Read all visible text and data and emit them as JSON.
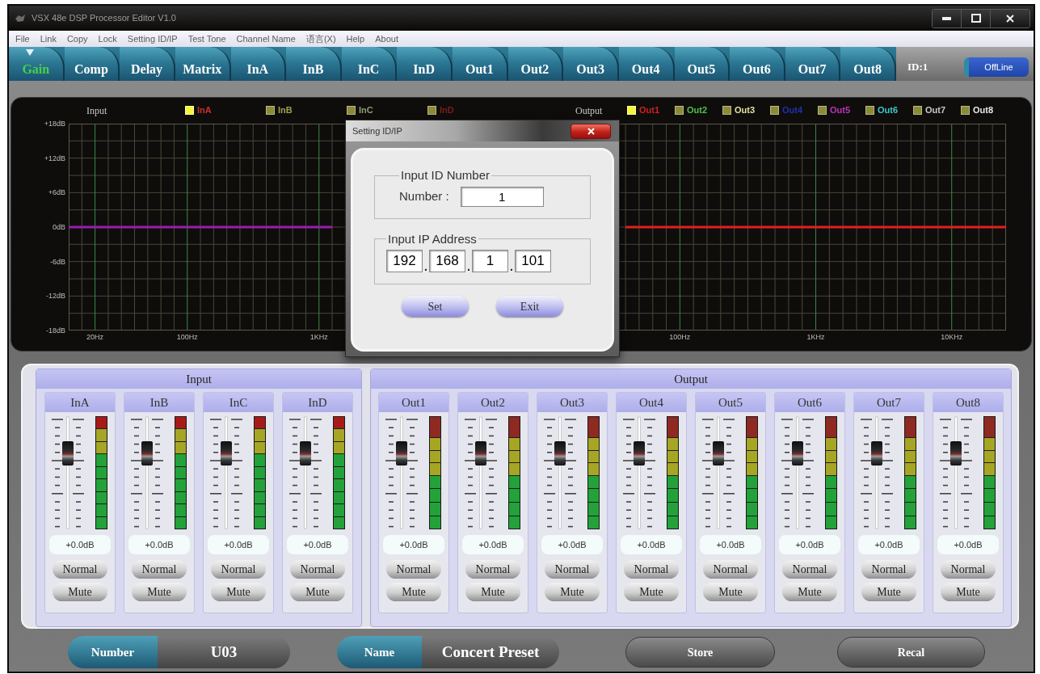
{
  "window": {
    "title": "VSX 48e DSP Processor Editor V1.0"
  },
  "menu": [
    "File",
    "Link",
    "Copy",
    "Lock",
    "Setting ID/IP",
    "Test Tone",
    "Channel Name",
    "语言(X)",
    "Help",
    "About"
  ],
  "tabs": [
    {
      "label": "Gain",
      "selected": true
    },
    {
      "label": "Comp",
      "selected": false
    },
    {
      "label": "Delay",
      "selected": false
    },
    {
      "label": "Matrix",
      "selected": false
    },
    {
      "label": "InA",
      "selected": false
    },
    {
      "label": "InB",
      "selected": false
    },
    {
      "label": "InC",
      "selected": false
    },
    {
      "label": "InD",
      "selected": false
    },
    {
      "label": "Out1",
      "selected": false
    },
    {
      "label": "Out2",
      "selected": false
    },
    {
      "label": "Out3",
      "selected": false
    },
    {
      "label": "Out4",
      "selected": false
    },
    {
      "label": "Out5",
      "selected": false
    },
    {
      "label": "Out6",
      "selected": false
    },
    {
      "label": "Out7",
      "selected": false
    },
    {
      "label": "Out8",
      "selected": false
    }
  ],
  "device": {
    "id": "ID:1",
    "status": "OffLine"
  },
  "charts": {
    "input": {
      "title": "Input",
      "legend": [
        {
          "label": "InA",
          "color": "#c83030",
          "checked": true
        },
        {
          "label": "InB",
          "color": "#9aa050",
          "checked": false
        },
        {
          "label": "InC",
          "color": "#88a070",
          "checked": false
        },
        {
          "label": "InD",
          "color": "#7a1c1c",
          "checked": false
        }
      ],
      "chart_data": [
        {
          "type": "line",
          "grid": true,
          "ylim": [
            -18,
            18
          ],
          "yticks": [
            {
              "value": 18,
              "label": "+18dB"
            },
            {
              "value": 12,
              "label": "+12dB"
            },
            {
              "value": 6,
              "label": "+6dB"
            },
            {
              "value": 0,
              "label": "0dB"
            },
            {
              "value": -6,
              "label": "-6dB"
            },
            {
              "value": -12,
              "label": "-12dB"
            },
            {
              "value": -18,
              "label": "-18dB"
            }
          ],
          "categories": [
            null,
            null,
            "20Hz",
            null,
            null,
            null,
            null,
            null,
            null,
            "100Hz",
            null,
            null,
            null,
            null,
            null,
            null,
            null,
            null,
            null,
            "1KHz",
            null,
            null,
            null,
            null,
            null,
            null,
            null,
            null,
            null,
            null,
            null,
            null,
            null,
            null
          ],
          "series": [
            {
              "color": "#9a1cb0",
              "values": [
                0,
                0,
                0,
                0,
                0,
                0,
                0,
                0,
                0,
                0,
                0,
                0,
                0,
                0,
                0,
                0,
                0,
                0,
                0,
                0,
                0,
                null,
                null,
                null,
                null,
                null,
                null,
                null,
                null,
                null,
                null,
                null,
                null,
                null
              ]
            }
          ]
        }
      ]
    },
    "output": {
      "title": "Output",
      "legend": [
        {
          "label": "Out1",
          "color": "#d02020",
          "checked": true
        },
        {
          "label": "Out2",
          "color": "#50c050",
          "checked": false
        },
        {
          "label": "Out3",
          "color": "#e0e0a0",
          "checked": false
        },
        {
          "label": "Out4",
          "color": "#2030b0",
          "checked": false
        },
        {
          "label": "Out5",
          "color": "#c030c0",
          "checked": false
        },
        {
          "label": "Out6",
          "color": "#40c8c8",
          "checked": false
        },
        {
          "label": "Out7",
          "color": "#c8c8c8",
          "checked": false
        },
        {
          "label": "Out8",
          "color": "#e8e8e8",
          "checked": false
        }
      ],
      "chart_data": [
        {
          "type": "line",
          "grid": true,
          "tick_labels": "x",
          "ylim": [
            -18,
            18
          ],
          "categories": [
            null,
            null,
            null,
            null,
            null,
            null,
            null,
            null,
            null,
            "100Hz",
            null,
            null,
            null,
            null,
            null,
            null,
            null,
            null,
            null,
            "1KHz",
            null,
            null,
            null,
            null,
            null,
            null,
            null,
            null,
            null,
            "10KHz",
            null,
            null,
            null,
            null
          ],
          "series": [
            {
              "color": "#e02020",
              "values": [
                null,
                null,
                null,
                null,
                null,
                0,
                0,
                0,
                0,
                0,
                0,
                0,
                0,
                0,
                0,
                0,
                0,
                0,
                0,
                0,
                0,
                0,
                0,
                0,
                0,
                0,
                0,
                0,
                0,
                0,
                0,
                0,
                0,
                0
              ]
            }
          ]
        }
      ]
    }
  },
  "dialog": {
    "title": "Setting ID/IP",
    "id_group": {
      "title": "Input ID Number",
      "label": "Number :",
      "value": "1"
    },
    "ip_group": {
      "title": "Input IP Address",
      "octets": [
        "192",
        "168",
        "1",
        "101"
      ],
      "separators": [
        ".",
        ".",
        "."
      ]
    },
    "buttons": [
      "Set",
      "Exit"
    ]
  },
  "mixer": {
    "input": {
      "title": "Input",
      "channels": [
        {
          "name": "InA",
          "fader": {
            "level": 0.67
          },
          "gain": "+0.0dB",
          "mode": "Normal",
          "mute": "Mute"
        },
        {
          "name": "InB",
          "fader": {
            "level": 0.67
          },
          "gain": "+0.0dB",
          "mode": "Normal",
          "mute": "Mute"
        },
        {
          "name": "InC",
          "fader": {
            "level": 0.67
          },
          "gain": "+0.0dB",
          "mode": "Normal",
          "mute": "Mute"
        },
        {
          "name": "InD",
          "fader": {
            "level": 0.67
          },
          "gain": "+0.0dB",
          "mode": "Normal",
          "mute": "Mute"
        }
      ]
    },
    "output": {
      "title": "Output",
      "channels": [
        {
          "name": "Out1",
          "fader": {
            "level": 0.67
          },
          "gain": "+0.0dB",
          "mode": "Normal",
          "mute": "Mute"
        },
        {
          "name": "Out2",
          "fader": {
            "level": 0.67
          },
          "gain": "+0.0dB",
          "mode": "Normal",
          "mute": "Mute"
        },
        {
          "name": "Out3",
          "fader": {
            "level": 0.67
          },
          "gain": "+0.0dB",
          "mode": "Normal",
          "mute": "Mute"
        },
        {
          "name": "Out4",
          "fader": {
            "level": 0.67
          },
          "gain": "+0.0dB",
          "mode": "Normal",
          "mute": "Mute"
        },
        {
          "name": "Out5",
          "fader": {
            "level": 0.67
          },
          "gain": "+0.0dB",
          "mode": "Normal",
          "mute": "Mute"
        },
        {
          "name": "Out6",
          "fader": {
            "level": 0.67
          },
          "gain": "+0.0dB",
          "mode": "Normal",
          "mute": "Mute"
        },
        {
          "name": "Out7",
          "fader": {
            "level": 0.67
          },
          "gain": "+0.0dB",
          "mode": "Normal",
          "mute": "Mute"
        },
        {
          "name": "Out8",
          "fader": {
            "level": 0.67
          },
          "gain": "+0.0dB",
          "mode": "Normal",
          "mute": "Mute"
        }
      ]
    }
  },
  "footer": {
    "number": {
      "label": "Number",
      "value": "U03"
    },
    "name": {
      "label": "Name",
      "value": "Concert Preset"
    },
    "buttons": [
      "Store",
      "Recal"
    ]
  }
}
